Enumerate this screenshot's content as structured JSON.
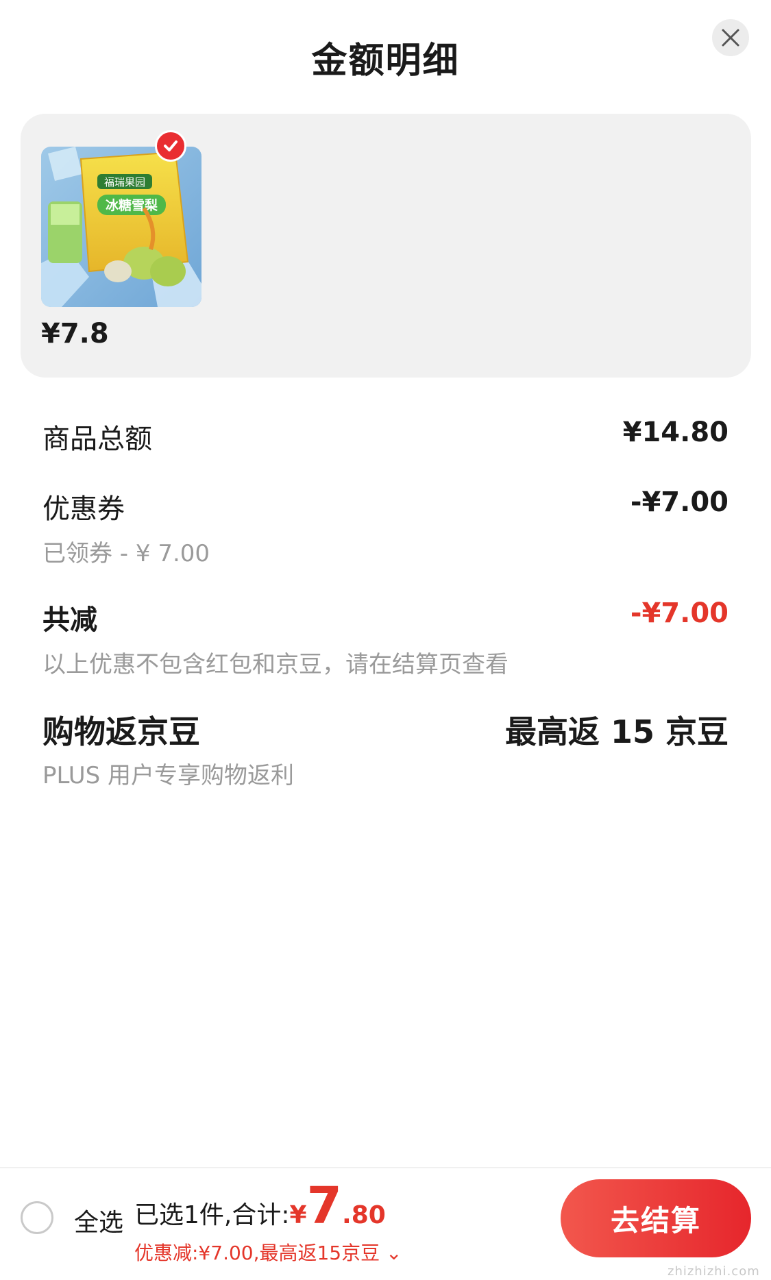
{
  "header": {
    "title": "金额明细"
  },
  "product": {
    "price": "¥7.8",
    "image_label_1": "福瑞果园",
    "image_label_2": "冰糖雪梨"
  },
  "rows": {
    "subtotal": {
      "label": "商品总额",
      "value": "¥14.80"
    },
    "coupon": {
      "label": "优惠券",
      "value": "-¥7.00",
      "sub": "已领券 - ¥ 7.00"
    },
    "total_discount": {
      "label": "共减",
      "value": "-¥7.00",
      "sub": "以上优惠不包含红包和京豆，请在结算页查看"
    },
    "beans": {
      "label": "购物返京豆",
      "value": "最高返 15 京豆",
      "sub": "PLUS 用户专享购物返利"
    }
  },
  "bottom": {
    "select_all": "全选",
    "selected_text": "已选1件,合计:",
    "currency": "¥",
    "total_int": "7",
    "total_dec": ".80",
    "discount_line": "优惠减:¥7.00,最高返15京豆 ⌄",
    "checkout": "去结算"
  },
  "watermark": {
    "text": "zhizhizhi.com"
  },
  "colors": {
    "accent_red": "#e4362a",
    "button_red": "#e92d31",
    "card_bg": "#f1f1f1"
  }
}
